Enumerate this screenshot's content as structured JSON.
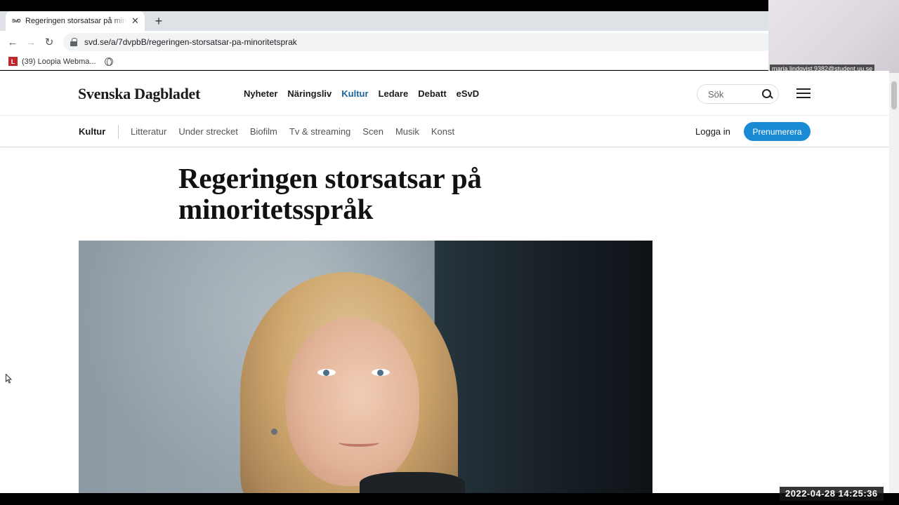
{
  "browser": {
    "tab_title": "Regeringen storsatsar på minoritetsspråk",
    "tab_favicon": "SvD",
    "url": "svd.se/a/7dvpbB/regeringen-storsatsar-pa-minoritetsprak",
    "bookmark_label": "(39) Loopia Webma...",
    "bookmark_icon_letter": "L"
  },
  "webcam": {
    "label": "maria.lindqvist.9382@student.uu.se"
  },
  "site": {
    "logo": "Svenska Dagbladet",
    "nav": [
      "Nyheter",
      "Näringsliv",
      "Kultur",
      "Ledare",
      "Debatt",
      "eSvD"
    ],
    "active_nav": "Kultur",
    "search_placeholder": "Sök",
    "sub_section": "Kultur",
    "sub_links": [
      "Litteratur",
      "Under strecket",
      "Biofilm",
      "Tv & streaming",
      "Scen",
      "Musik",
      "Konst"
    ],
    "login": "Logga in",
    "subscribe": "Prenumerera",
    "accent_color": "#1a8ad4",
    "active_nav_color": "#1a6596"
  },
  "article": {
    "headline": "Regeringen storsatsar på minoritetsspråk"
  },
  "overlay": {
    "timestamp": "2022-04-28  14:25:36"
  }
}
